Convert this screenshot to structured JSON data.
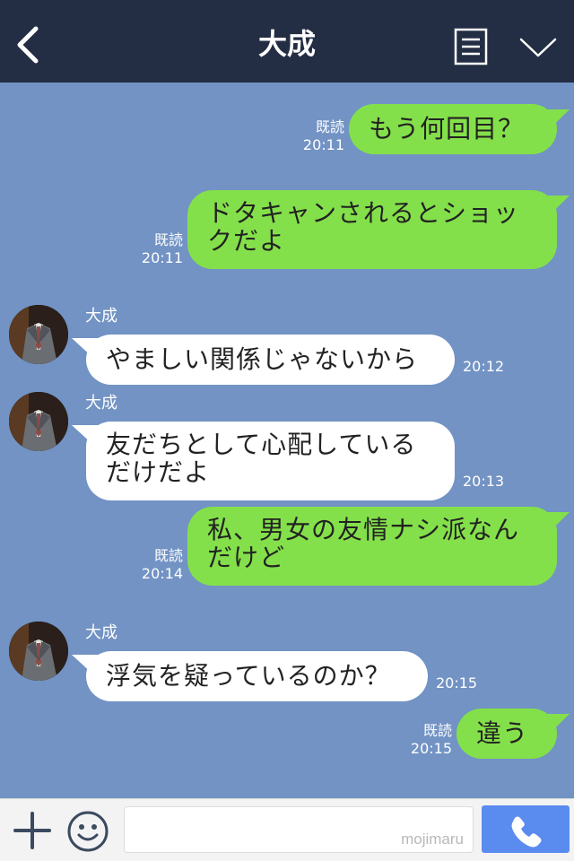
{
  "header": {
    "title": "大成",
    "icons": [
      "back-icon",
      "menu-icon",
      "chevron-down-icon"
    ],
    "background": "#232d43"
  },
  "chat_background": "#7293c4",
  "messages": [
    {
      "side": "out",
      "text_lines": [
        "もう何回目？"
      ],
      "read": "既読",
      "time": "20:11"
    },
    {
      "side": "out",
      "text_lines": [
        "ドタキャンされるとショッ",
        "クだよ"
      ],
      "read": "既読",
      "time": "20:11"
    },
    {
      "side": "in",
      "sender": "大成",
      "text_lines": [
        "やましい関係じゃないから"
      ],
      "time": "20:12"
    },
    {
      "side": "in",
      "sender": "大成",
      "text_lines": [
        "友だちとして心配している",
        "だけだよ"
      ],
      "time": "20:13"
    },
    {
      "side": "out",
      "text_lines": [
        "私、男女の友情ナシ派なん",
        "だけど"
      ],
      "read": "既読",
      "time": "20:14"
    },
    {
      "side": "in",
      "sender": "大成",
      "text_lines": [
        "浮気を疑っているのか？"
      ],
      "time": "20:15"
    },
    {
      "side": "out",
      "text_lines": [
        "違う"
      ],
      "read": "既読",
      "time": "20:15"
    }
  ],
  "colors": {
    "outgoing_bubble": "#84e04a",
    "incoming_bubble": "#ffffff",
    "call_button": "#5a8cf0"
  },
  "footer": {
    "icons": [
      "plus-icon",
      "emoji-icon",
      "phone-icon"
    ],
    "input_value": "",
    "watermark": "mojimaru"
  }
}
